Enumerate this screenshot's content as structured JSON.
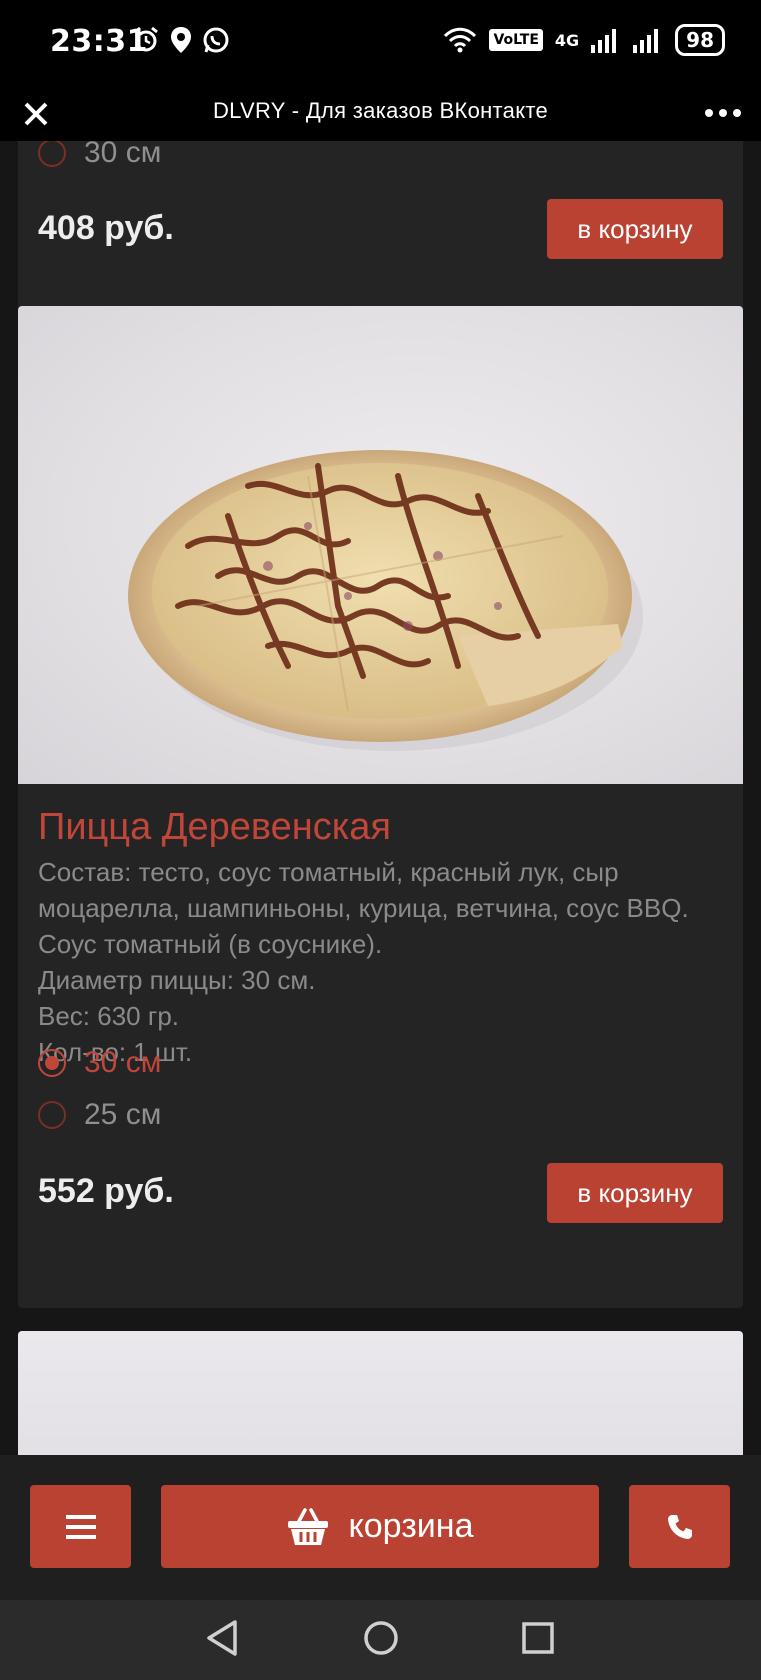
{
  "status_bar": {
    "time": "23:31",
    "volte": "VoLTE",
    "sim_indicator": "1 2",
    "network": "4G",
    "battery": "98"
  },
  "title_bar": {
    "title": "DLVRY - Для заказов ВКонтакте"
  },
  "previous_product": {
    "size_option": "30 см",
    "price": "408 руб.",
    "add_to_cart": "в корзину"
  },
  "product": {
    "name": "Пицца Деревенская",
    "description_lines": [
      "Состав: тесто, соус томатный, красный лук, сыр моцарелла, шампиньоны, курица, ветчина, соус BBQ. Соус томатный (в соуснике).",
      "Диаметр пиццы: 30 см.",
      "Вес: 630 гр.",
      "Кол-во: 1 шт."
    ],
    "size_options": [
      {
        "label": "30 см",
        "selected": true
      },
      {
        "label": "25 см",
        "selected": false
      }
    ],
    "price": "552 руб.",
    "add_to_cart": "в корзину"
  },
  "bottom_bar": {
    "cart_label": "корзина"
  },
  "colors": {
    "accent": "#b94233",
    "accent_text": "#c0463a",
    "card_bg": "#242424",
    "page_bg": "#161616"
  }
}
